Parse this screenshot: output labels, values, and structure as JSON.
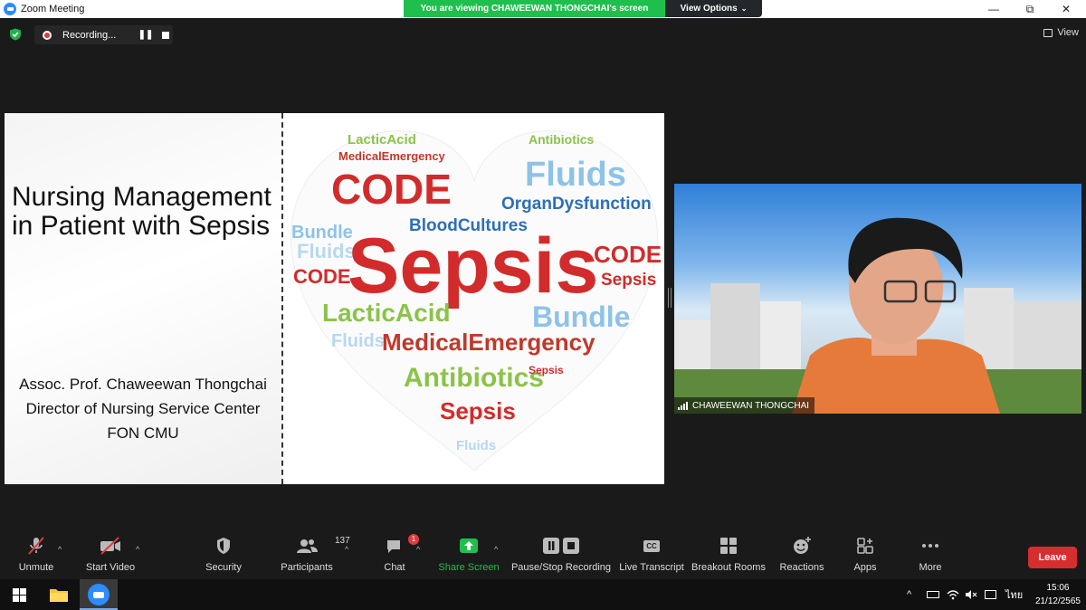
{
  "window": {
    "title": "Zoom Meeting"
  },
  "banner": {
    "viewing": "You are viewing CHAWEEWAN THONGCHAI's screen",
    "view_options": "View Options"
  },
  "recording": {
    "label": "Recording..."
  },
  "view_button": {
    "label": "View"
  },
  "slide": {
    "title": "Nursing Management in Patient with Sepsis",
    "author_line1": "Assoc. Prof. Chaweewan Thongchai",
    "author_line2": "Director of Nursing Service Center",
    "author_line3": "FON CMU",
    "cloud_words": {
      "sepsis": "Sepsis",
      "code": "CODE",
      "fluids": "Fluids",
      "lactic": "LacticAcid",
      "antibiotics": "Antibiotics",
      "medical": "MedicalEmergency",
      "organ": "OrganDysfunction",
      "blood": "BloodCultures",
      "bundle": "Bundle"
    }
  },
  "speaker": {
    "name": "CHAWEEWAN THONGCHAI"
  },
  "toolbar": {
    "unmute": "Unmute",
    "start_video": "Start Video",
    "security": "Security",
    "participants": "Participants",
    "participants_count": "137",
    "chat": "Chat",
    "chat_badge": "1",
    "share_screen": "Share Screen",
    "pause_stop": "Pause/Stop Recording",
    "live_transcript": "Live Transcript",
    "cc": "CC",
    "breakout": "Breakout Rooms",
    "reactions": "Reactions",
    "apps": "Apps",
    "more": "More",
    "leave": "Leave"
  },
  "taskbar": {
    "language": "ไทย",
    "time": "15:06",
    "date": "21/12/2565"
  },
  "colors": {
    "zoom_blue": "#2d8cff",
    "share_green": "#1fbf4e",
    "leave_red": "#d62e2e",
    "rec_red": "#e0393e"
  }
}
